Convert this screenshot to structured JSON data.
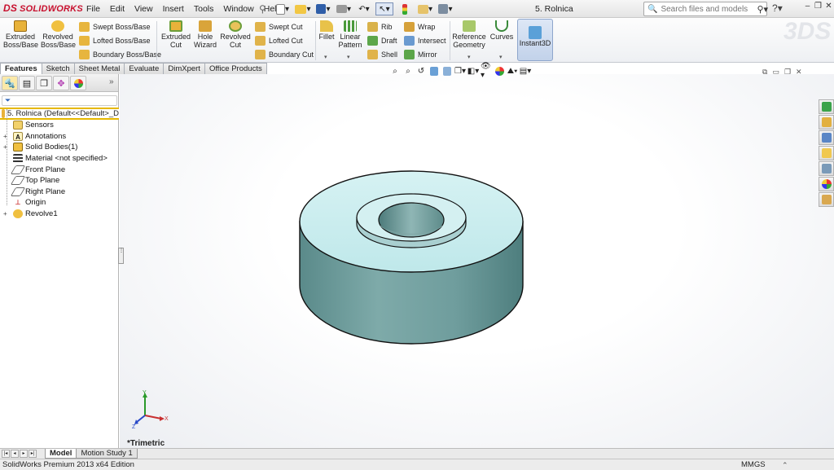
{
  "app": {
    "logo": "SOLIDWORKS",
    "logo_mark": "DS",
    "doc_title": "5. Rolnica"
  },
  "menu": [
    "File",
    "Edit",
    "View",
    "Insert",
    "Tools",
    "Window",
    "Help"
  ],
  "search": {
    "placeholder": "Search files and models"
  },
  "help_label": "?",
  "ribbon": {
    "extruded_boss": "Extruded\nBoss/Base",
    "revolved_boss": "Revolved\nBoss/Base",
    "swept_boss": "Swept Boss/Base",
    "lofted_boss": "Lofted Boss/Base",
    "boundary_boss": "Boundary Boss/Base",
    "extruded_cut": "Extruded\nCut",
    "hole_wizard": "Hole\nWizard",
    "revolved_cut": "Revolved\nCut",
    "swept_cut": "Swept Cut",
    "lofted_cut": "Lofted Cut",
    "boundary_cut": "Boundary Cut",
    "fillet": "Fillet",
    "linear_pattern": "Linear\nPattern",
    "rib": "Rib",
    "draft": "Draft",
    "shell": "Shell",
    "wrap": "Wrap",
    "intersect": "Intersect",
    "mirror": "Mirror",
    "reference_geometry": "Reference\nGeometry",
    "curves": "Curves",
    "instant3d": "Instant3D"
  },
  "command_tabs": [
    "Features",
    "Sketch",
    "Sheet Metal",
    "Evaluate",
    "DimXpert",
    "Office Products"
  ],
  "tree": {
    "root": "5. Rolnica  (Default<<Default>_D",
    "items": [
      {
        "label": "Sensors",
        "expand": "",
        "icon": "sensor-icon"
      },
      {
        "label": "Annotations",
        "expand": "+",
        "icon": "annotation-icon"
      },
      {
        "label": "Solid Bodies(1)",
        "expand": "+",
        "icon": "solid-bodies-icon"
      },
      {
        "label": "Material <not specified>",
        "expand": "",
        "icon": "material-icon"
      },
      {
        "label": "Front Plane",
        "expand": "",
        "icon": "plane-icon"
      },
      {
        "label": "Top Plane",
        "expand": "",
        "icon": "plane-icon"
      },
      {
        "label": "Right Plane",
        "expand": "",
        "icon": "plane-icon"
      },
      {
        "label": "Origin",
        "expand": "",
        "icon": "origin-icon"
      },
      {
        "label": "Revolve1",
        "expand": "+",
        "icon": "revolve-icon"
      }
    ]
  },
  "view": {
    "name": "*Trimetric",
    "axis_x": "X",
    "axis_y": "Y",
    "axis_z": "Z"
  },
  "bottom_tabs": [
    "Model",
    "Motion Study 1"
  ],
  "status": {
    "text": "SolidWorks Premium 2013 x64 Edition",
    "units": "MMGS"
  },
  "colors": {
    "model_face": "#c2ebec",
    "model_side": "#6f9d9d",
    "accent": "#e6b800"
  }
}
